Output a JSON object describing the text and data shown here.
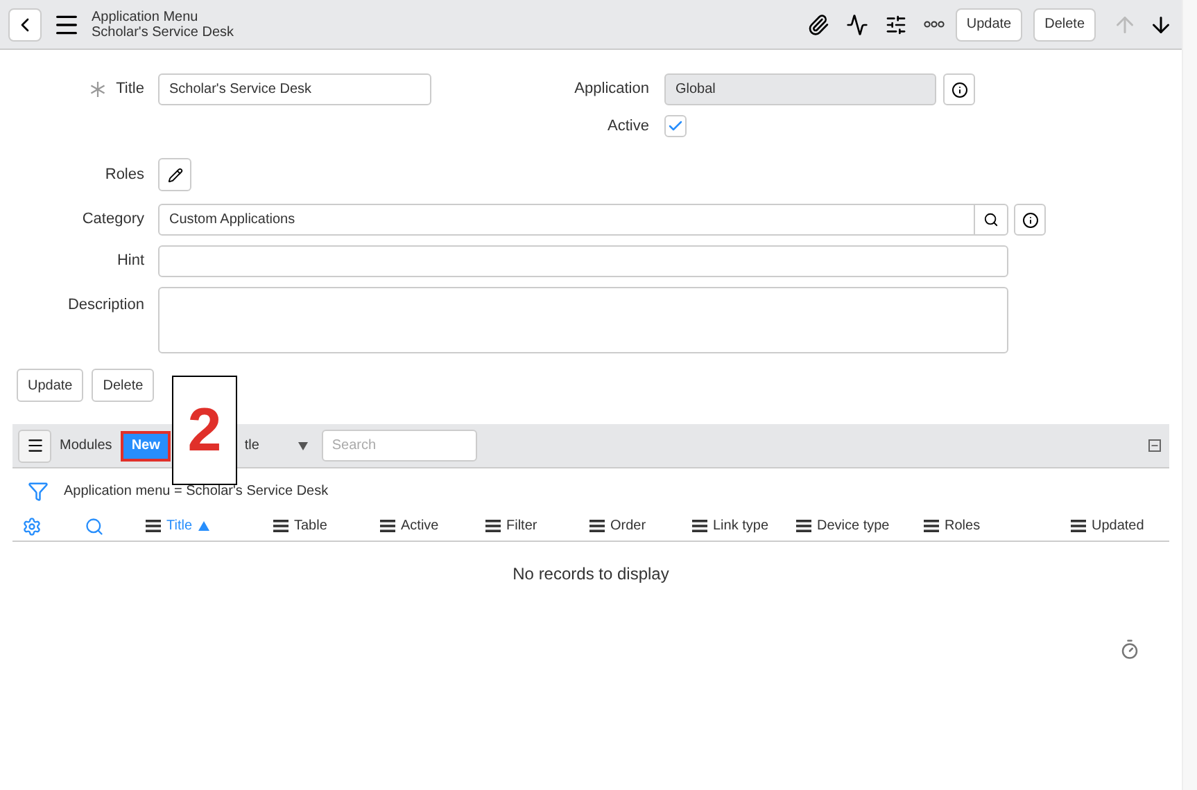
{
  "header": {
    "title": "Application Menu",
    "subtitle": "Scholar's Service Desk",
    "buttons": [
      "Update",
      "Delete"
    ]
  },
  "form": {
    "title": {
      "label": "Title",
      "value": "Scholar's Service Desk",
      "required": true
    },
    "application": {
      "label": "Application",
      "value": "Global",
      "disabled": true
    },
    "active": {
      "label": "Active",
      "checked": true
    },
    "roles": {
      "label": "Roles"
    },
    "category": {
      "label": "Category",
      "value": "Custom Applications"
    },
    "hint": {
      "label": "Hint"
    },
    "description": {
      "label": "Description"
    }
  },
  "form_buttons": [
    "Update",
    "Delete"
  ],
  "callout": "2",
  "related_list": {
    "title": "Modules",
    "new_button": "New",
    "filter_field": "tle",
    "search_placeholder": "Search",
    "breadcrumb": "Application menu = Scholar's Service Desk",
    "columns": [
      {
        "label": "Title",
        "sorted": true
      },
      {
        "label": "Table",
        "sorted": false
      },
      {
        "label": "Active",
        "sorted": false
      },
      {
        "label": "Filter",
        "sorted": false
      },
      {
        "label": "Order",
        "sorted": false
      },
      {
        "label": "Link type",
        "sorted": false
      },
      {
        "label": "Device type",
        "sorted": false
      },
      {
        "label": "Roles",
        "sorted": false
      },
      {
        "label": "Updated",
        "sorted": false
      }
    ],
    "empty_message": "No records to display"
  }
}
